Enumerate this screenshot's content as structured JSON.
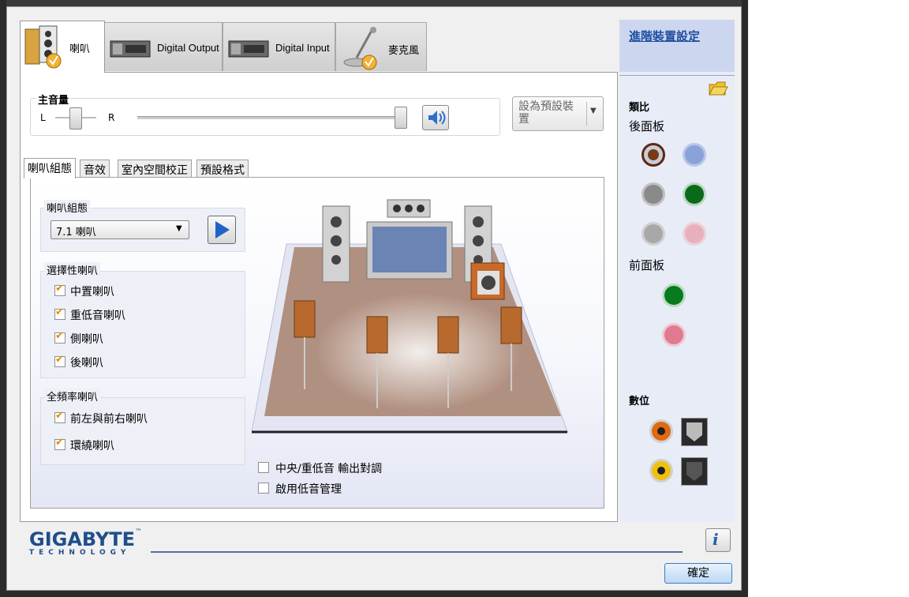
{
  "device_tabs": [
    {
      "label": "喇叭",
      "icon": "speaker-icon"
    },
    {
      "label": "Digital Output",
      "icon": "digital-output-icon"
    },
    {
      "label": "Digital Input",
      "icon": "digital-input-icon"
    },
    {
      "label": "麥克風",
      "icon": "microphone-icon"
    }
  ],
  "volume": {
    "title": "主音量",
    "left_label": "L",
    "right_label": "R",
    "balance_level": 0.5,
    "main_level": 1.0,
    "set_default_label": "設為預設裝置"
  },
  "sub_tabs": [
    "喇叭組態",
    "音效",
    "室內空間校正",
    "預設格式"
  ],
  "config": {
    "group_title": "喇叭組態",
    "selected": "7.1 喇叭"
  },
  "optional": {
    "title": "選擇性喇叭",
    "items": [
      {
        "label": "中置喇叭",
        "checked": true
      },
      {
        "label": "重低音喇叭",
        "checked": true
      },
      {
        "label": "側喇叭",
        "checked": true
      },
      {
        "label": "後喇叭",
        "checked": true
      }
    ]
  },
  "fullrange": {
    "title": "全頻率喇叭",
    "items": [
      {
        "label": "前左與前右喇叭",
        "checked": true
      },
      {
        "label": "環繞喇叭",
        "checked": true
      }
    ]
  },
  "bottom_options": [
    {
      "label": "中央/重低音 輸出對調",
      "checked": false
    },
    {
      "label": "啟用低音管理",
      "checked": false
    }
  ],
  "side": {
    "advanced_link": "進階裝置設定",
    "analog_title": "類比",
    "rear_panel": "後面板",
    "front_panel": "前面板",
    "digital_title": "數位"
  },
  "footer": {
    "brand": "GIGABYTE",
    "brand_tm": "™",
    "brand_sub": "TECHNOLOGY",
    "ok_label": "確定"
  }
}
